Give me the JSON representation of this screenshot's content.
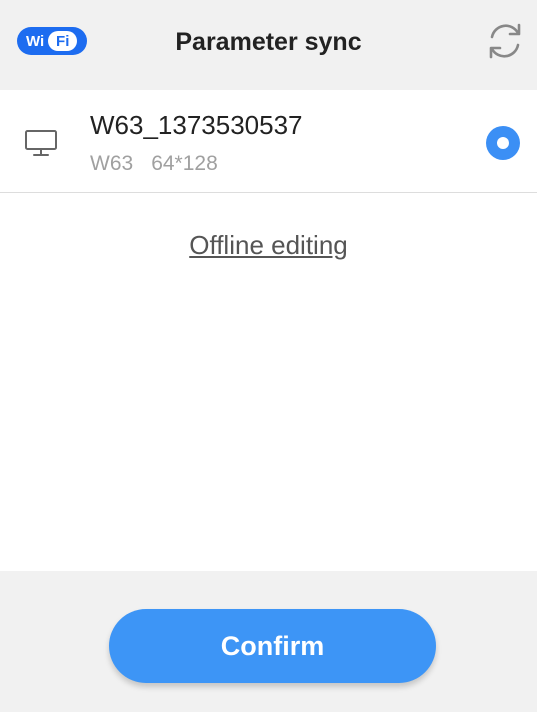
{
  "header": {
    "wifi_badge": {
      "left": "Wi",
      "right": "Fi"
    },
    "title": "Parameter sync",
    "refresh_icon": "refresh-icon"
  },
  "device": {
    "name": "W63_1373530537",
    "model": "W63",
    "resolution": "64*128",
    "icon": "monitor-icon",
    "selected": true
  },
  "offline_link": "Offline editing",
  "footer": {
    "confirm_label": "Confirm"
  },
  "colors": {
    "accent": "#3d95f6",
    "wifi_badge": "#1d6cf0",
    "header_bg": "#f1f1f1",
    "muted_text": "#a0a0a0"
  }
}
